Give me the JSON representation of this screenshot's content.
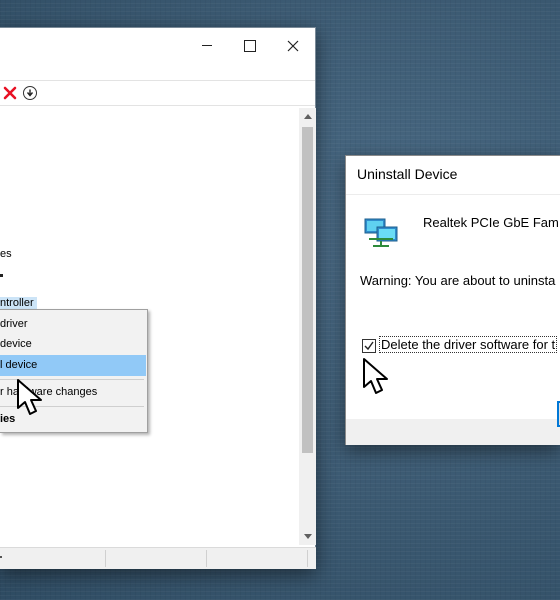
{
  "device_manager": {
    "title_bar": {
      "minimize_icon": "minimize-icon",
      "maximize_icon": "maximize-icon",
      "close_icon": "close-icon"
    },
    "toolbar": {
      "uninstall_icon": "red-x-icon",
      "update_driver_icon": "download-arrow-icon"
    },
    "tree_fragments": {
      "item_es": "es",
      "item_controller": "ntroller"
    }
  },
  "context_menu": {
    "items": [
      {
        "label": "driver"
      },
      {
        "label": "device"
      },
      {
        "label": "l device",
        "highlighted": true
      },
      {
        "label": "r hardware changes"
      },
      {
        "label": "ies",
        "bold": true
      }
    ]
  },
  "uninstall_dialog": {
    "title": "Uninstall Device",
    "device_name": "Realtek PCIe GbE Fam",
    "warning": "Warning: You are about to uninsta",
    "checkbox_label": "Delete the driver software for t",
    "checkbox_checked": true,
    "accent_color": "#0078d7"
  },
  "colors": {
    "desktop": "#3d5c75",
    "menu_highlight": "#91c9f7",
    "selection": "#cce4f7",
    "toolbar_x": "#e81123"
  }
}
